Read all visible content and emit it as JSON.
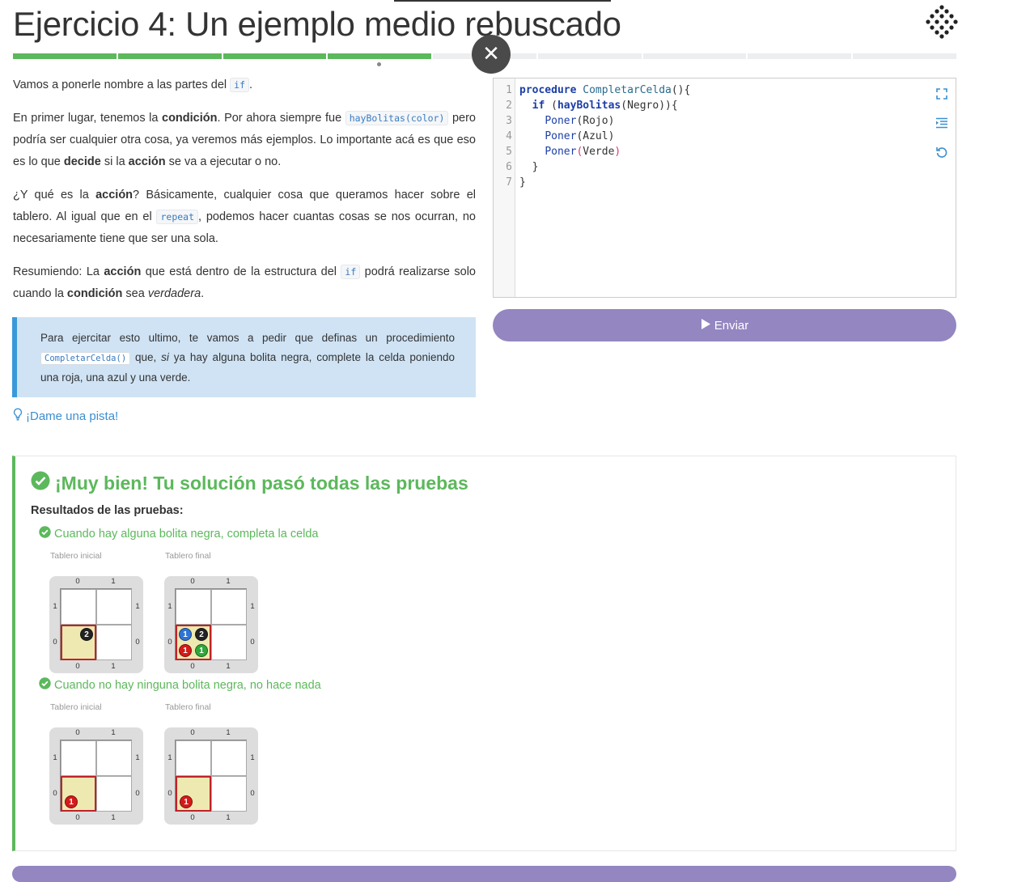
{
  "header": {
    "title": "Ejercicio 4: Un ejemplo medio rebuscado",
    "close_glyph": "✕",
    "logo_icon": "gobstones-logo-icon"
  },
  "progress": {
    "segments": 9,
    "completed": 4,
    "current": 4
  },
  "description": {
    "p1": {
      "a": "Vamos a ponerle nombre a las partes del ",
      "code": "if",
      "b": "."
    },
    "p2": {
      "a": "En primer lugar, tenemos la ",
      "b1": "condición",
      "c": ". Por ahora siempre fue ",
      "code": "hayBolitas(color)",
      "d": " pero podría ser cualquier otra cosa, ya veremos más ejemplos. Lo importante acá es que eso es lo que ",
      "b2": "decide",
      "e": " si la ",
      "b3": "acción",
      "f": " se va a ejecutar o no."
    },
    "p3": {
      "a": "¿Y qué es la ",
      "b1": "acción",
      "c": "? Básicamente, cualquier cosa que queramos hacer sobre el tablero. Al igual que en el ",
      "code": "repeat",
      "d": ", podemos hacer cuantas cosas se nos ocurran, no necesariamente tiene que ser una sola."
    },
    "p4": {
      "a": "Resumiendo: La ",
      "b1": "acción",
      "c": " que está dentro de la estructura del ",
      "code": "if",
      "d": " podrá realizarse solo cuando la ",
      "b2": "condición",
      "e": " sea ",
      "i": "verdadera",
      "f": "."
    }
  },
  "callout": {
    "a": "Para ejercitar esto ultimo, te vamos a pedir que definas un procedimiento ",
    "code": "CompletarCelda()",
    "b": " que, ",
    "i": "si",
    "c": " ya hay alguna bolita negra, complete la celda poniendo una roja, una azul y una verde."
  },
  "hint": {
    "label": "¡Dame una pista!",
    "icon": "lightbulb-icon"
  },
  "editor": {
    "line_numbers": [
      "1",
      "2",
      "3",
      "4",
      "5",
      "6",
      "7"
    ],
    "code": {
      "l1_kw": "procedure",
      "l1_fn": " CompletarCelda",
      "l1_rest": "(){",
      "l2_indent": "  ",
      "l2_kw": "if",
      "l2_open": " (",
      "l2_fn": "hayBolitas",
      "l2_rest": "(Negro)){",
      "l3_indent": "    ",
      "l3_cmd": "Poner",
      "l3_rest": "(Rojo)",
      "l4_indent": "    ",
      "l4_cmd": "Poner",
      "l4_rest": "(Azul)",
      "l5_indent": "    ",
      "l5_cmd": "Poner",
      "l5_open": "(",
      "l5_arg": "Verde",
      "l5_close": ")",
      "l6": "  }",
      "l7": "}"
    },
    "tools": [
      "fullscreen-icon",
      "indent-icon",
      "reset-icon"
    ]
  },
  "submit": {
    "label": "Enviar",
    "icon": "play-icon"
  },
  "results": {
    "title": "¡Muy bien! Tu solución pasó todas las pruebas",
    "subtitle": "Resultados de las pruebas:",
    "tests": [
      {
        "name": "Cuando hay alguna bolita negra, completa la celda",
        "initial_label": "Tablero inicial",
        "final_label": "Tablero final",
        "initial_board": {
          "cols": [
            "0",
            "1"
          ],
          "rows": [
            "1",
            "0"
          ],
          "balls": [
            {
              "color": "negro",
              "count": "2"
            }
          ]
        },
        "final_board": {
          "cols": [
            "0",
            "1"
          ],
          "rows": [
            "1",
            "0"
          ],
          "balls": [
            {
              "color": "azul",
              "count": "1"
            },
            {
              "color": "negro",
              "count": "2"
            },
            {
              "color": "rojo",
              "count": "1"
            },
            {
              "color": "verde",
              "count": "1"
            }
          ]
        }
      },
      {
        "name": "Cuando no hay ninguna bolita negra, no hace nada",
        "initial_label": "Tablero inicial",
        "final_label": "Tablero final",
        "initial_board": {
          "cols": [
            "0",
            "1"
          ],
          "rows": [
            "1",
            "0"
          ],
          "balls": [
            {
              "color": "rojo",
              "count": "1"
            }
          ]
        },
        "final_board": {
          "cols": [
            "0",
            "1"
          ],
          "rows": [
            "1",
            "0"
          ],
          "balls": [
            {
              "color": "rojo",
              "count": "1"
            }
          ]
        }
      }
    ]
  },
  "colors": {
    "success": "#5cb85c",
    "accent_purple": "#9486c1",
    "link": "#3a8fd0",
    "callout_bg": "#cfe3f4",
    "head_cell": "#eee9b0"
  }
}
